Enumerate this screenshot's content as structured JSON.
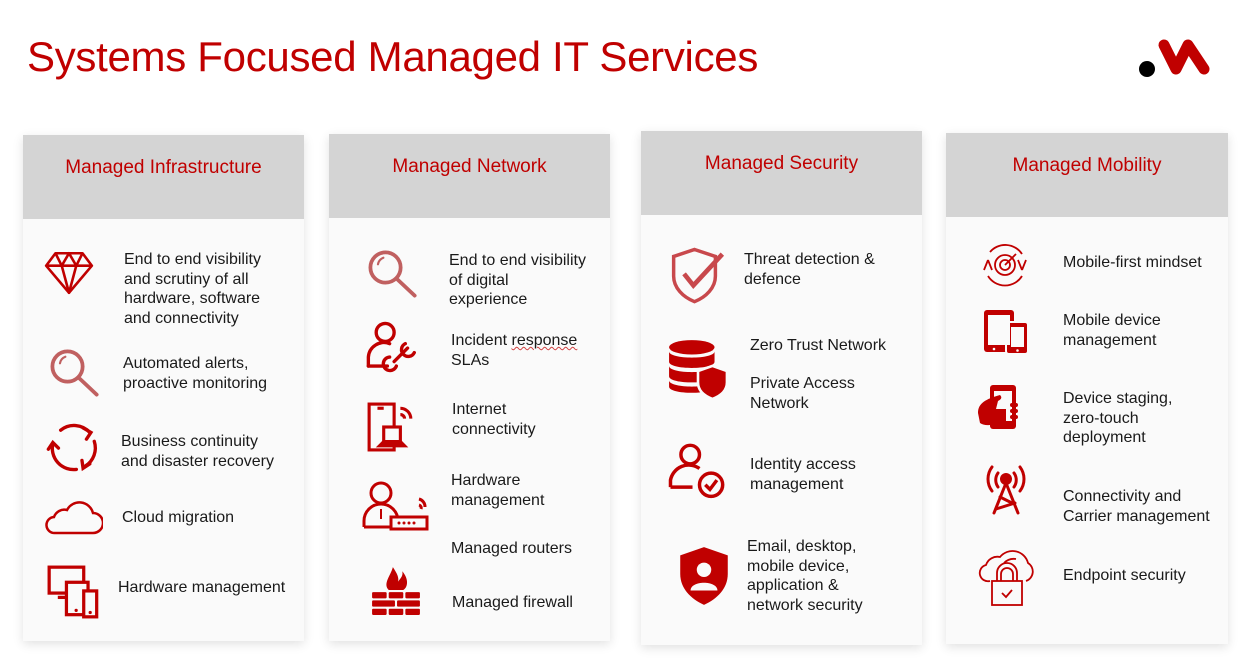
{
  "title": "Systems Focused Managed IT Services",
  "brand_color": "#c00000",
  "logo": "dot-m-logo-icon",
  "columns": [
    {
      "heading": "Managed Infrastructure",
      "items": [
        {
          "icon": "diamond-icon",
          "text": "End to end visibility\nand scrutiny of all\nhardware, software\nand connectivity"
        },
        {
          "icon": "magnifier-icon",
          "text": "Automated alerts,\nproactive monitoring"
        },
        {
          "icon": "cycle-arrows-icon",
          "text": "Business continuity\nand disaster recovery"
        },
        {
          "icon": "cloud-icon",
          "text": "Cloud migration"
        },
        {
          "icon": "devices-icon",
          "text": "Hardware management"
        }
      ]
    },
    {
      "heading": "Managed Network",
      "items": [
        {
          "icon": "magnifier-icon",
          "text": "End to end visibility\nof digital\nexperience"
        },
        {
          "icon": "user-wrench-icon",
          "text_a": "Incident ",
          "text_b": "response",
          "text_c": "\nSLAs"
        },
        {
          "icon": "phone-laptop-wifi-icon",
          "text": "Internet\nconnectivity"
        },
        {
          "icon": "user-router-icon",
          "text": "Hardware\nmanagement"
        },
        {
          "icon": "none",
          "text": "Managed routers"
        },
        {
          "icon": "firewall-icon",
          "text": "Managed firewall"
        }
      ]
    },
    {
      "heading": "Managed Security",
      "items": [
        {
          "icon": "shield-check-icon",
          "text": "Threat detection &\ndefence"
        },
        {
          "icon": "database-shield-icon",
          "text": "Zero Trust Network"
        },
        {
          "icon": "none",
          "text": "Private Access\nNetwork"
        },
        {
          "icon": "user-check-icon",
          "text": "Identity access\nmanagement"
        },
        {
          "icon": "shield-user-icon",
          "text": "Email, desktop,\nmobile device,\napplication &\nnetwork security"
        }
      ]
    },
    {
      "heading": "Managed Mobility",
      "items": [
        {
          "icon": "target-cycle-icon",
          "text": "Mobile-first mindset"
        },
        {
          "icon": "tablet-phone-icon",
          "text": "Mobile device\nmanagement"
        },
        {
          "icon": "hand-phone-icon",
          "text": "Device staging,\nzero-touch\ndeployment"
        },
        {
          "icon": "cell-tower-icon",
          "text": "Connectivity and\nCarrier management"
        },
        {
          "icon": "cloud-lock-icon",
          "text": "Endpoint security"
        }
      ]
    }
  ]
}
